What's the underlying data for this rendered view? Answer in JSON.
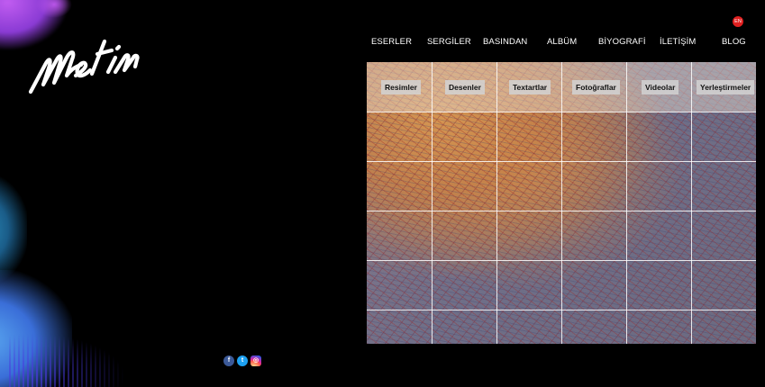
{
  "brand": {
    "logo_text": "Metin"
  },
  "language": {
    "label": "EN"
  },
  "nav": {
    "items": [
      "ESERLER",
      "SERGİLER",
      "BASINDAN",
      "ALBÜM",
      "BİYOGRAFİ",
      "İLETİŞİM",
      "BLOG"
    ]
  },
  "categories": [
    "Resimler",
    "Desenler",
    "Textartlar",
    "Fotoğraflar",
    "Videolar",
    "Yerleştirmeler"
  ],
  "social": [
    {
      "name": "facebook-icon",
      "glyph": "f"
    },
    {
      "name": "twitter-icon",
      "glyph": "t"
    },
    {
      "name": "instagram-icon",
      "glyph": "◎"
    }
  ],
  "colors": {
    "background": "#000000",
    "lang_badge": "#e02020",
    "label_bg": "#d2d2d2"
  }
}
